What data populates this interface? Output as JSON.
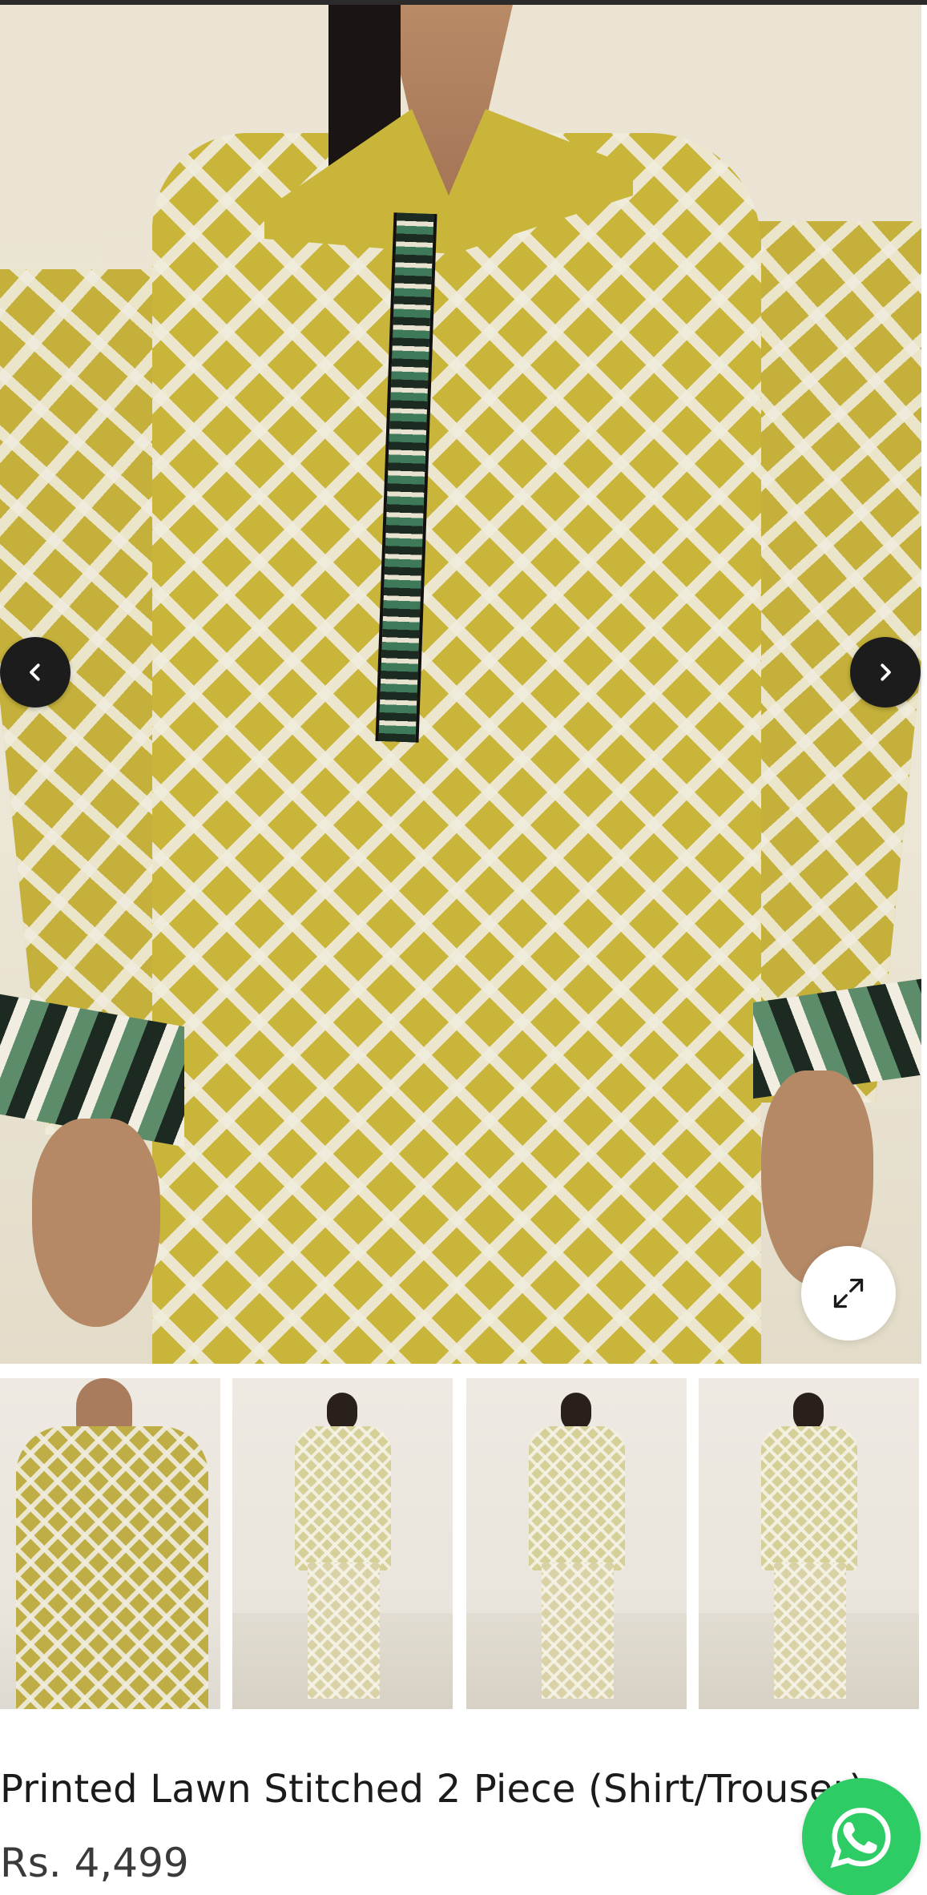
{
  "product": {
    "title": "Printed Lawn Stitched 2 Piece (Shirt/Trouser)",
    "price": "Rs. 4,499"
  },
  "gallery": {
    "main_image_alt": "Model wearing yellow printed lawn shirt",
    "prev_icon": "chevron-left-icon",
    "next_icon": "chevron-right-icon",
    "zoom_icon": "expand-icon",
    "thumbnails": [
      {
        "alt": "Close-up of printed shirt"
      },
      {
        "alt": "Full outfit front view"
      },
      {
        "alt": "Full outfit front view alternate"
      },
      {
        "alt": "Full outfit pose"
      }
    ]
  },
  "contact": {
    "whatsapp_icon": "whatsapp-icon"
  },
  "colors": {
    "accent_dark": "#1c1c1c",
    "whatsapp_green": "#2ecc64",
    "fabric_yellow": "#c9b53a"
  }
}
